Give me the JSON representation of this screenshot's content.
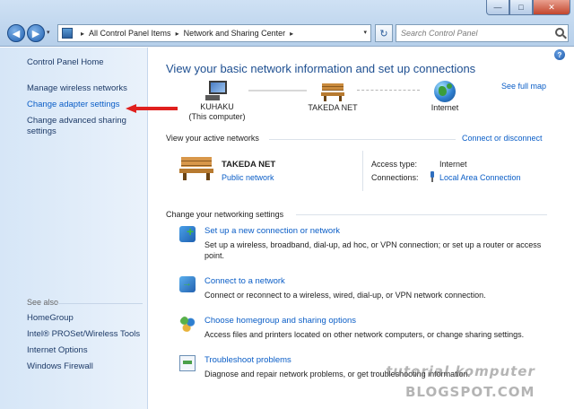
{
  "window": {
    "title_controls": {
      "minimize": "—",
      "maximize": "□",
      "close": "✕"
    }
  },
  "address_bar": {
    "crumbs": [
      "All Control Panel Items",
      "Network and Sharing Center"
    ],
    "separator": "▸",
    "dropdown": "▾",
    "refresh": "↻"
  },
  "search": {
    "placeholder": "Search Control Panel"
  },
  "sidebar": {
    "home": "Control Panel Home",
    "items": [
      {
        "label": "Manage wireless networks"
      },
      {
        "label": "Change adapter settings"
      },
      {
        "label": "Change advanced sharing\nsettings"
      }
    ],
    "see_also_heading": "See also",
    "see_also": [
      {
        "label": "HomeGroup"
      },
      {
        "label": "Intel® PROSet/Wireless Tools"
      },
      {
        "label": "Internet Options"
      },
      {
        "label": "Windows Firewall"
      }
    ]
  },
  "main": {
    "title": "View your basic network information and set up connections",
    "see_full_map": "See full map",
    "map": {
      "computer_name": "KUHAKU",
      "computer_sub": "(This computer)",
      "network_name": "TAKEDA NET",
      "internet": "Internet"
    },
    "active_heading": "View your active networks",
    "connect_disconnect": "Connect or disconnect",
    "active": {
      "name": "TAKEDA NET",
      "type": "Public network",
      "access_type_label": "Access type:",
      "access_type_value": "Internet",
      "connections_label": "Connections:",
      "connections_value": "Local Area Connection"
    },
    "change_heading": "Change your networking settings",
    "tasks": [
      {
        "title": "Set up a new connection or network",
        "desc": "Set up a wireless, broadband, dial-up, ad hoc, or VPN connection; or set up a router or access point."
      },
      {
        "title": "Connect to a network",
        "desc": "Connect or reconnect to a wireless, wired, dial-up, or VPN network connection."
      },
      {
        "title": "Choose homegroup and sharing options",
        "desc": "Access files and printers located on other network computers, or change sharing settings."
      },
      {
        "title": "Troubleshoot problems",
        "desc": "Diagnose and repair network problems, or get troubleshooting information."
      }
    ],
    "help": "?"
  },
  "watermark": {
    "line1": "tutorial komputer",
    "line2": "BLOGSPOT.COM"
  },
  "colors": {
    "link": "#0b5ec7",
    "title": "#1e4f91",
    "sidebar": "#d6e6f7",
    "arrow": "#e0201e"
  }
}
